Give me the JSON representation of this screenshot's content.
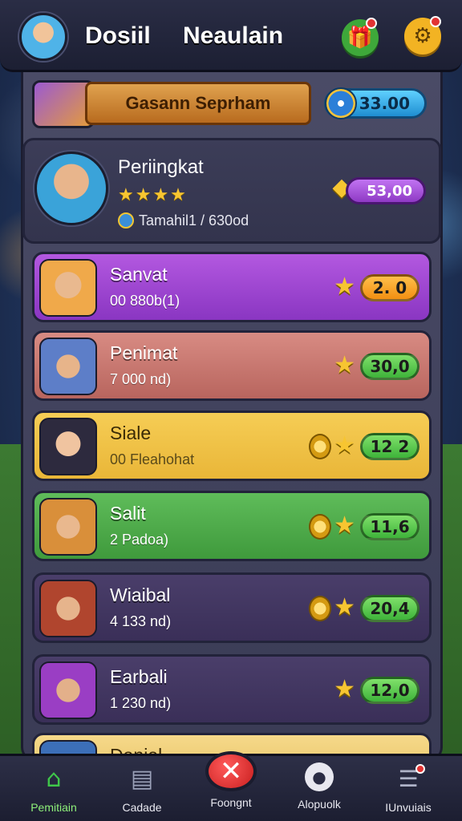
{
  "topbar": {
    "title_left": "Dosiil",
    "title_right": "Neaulain"
  },
  "header": {
    "event_banner": "Gasann Seprham",
    "currency_value": "33.00"
  },
  "player": {
    "name": "Periingkat",
    "stars": "★★★★",
    "subtitle": "Tamahil1 / 630od",
    "score": "53,00"
  },
  "rows": [
    {
      "name": "Sanvat",
      "sub": "00 880b(1)",
      "value": "2. 0"
    },
    {
      "name": "Penimat",
      "sub": "7 000 nd)",
      "value": "30,0"
    },
    {
      "name": "Siale",
      "sub": "00 Fleahohat",
      "value": "12 2"
    },
    {
      "name": "Salit",
      "sub": "2 Padoa)",
      "value": "11,6"
    },
    {
      "name": "Wiaibal",
      "sub": "4 133 nd)",
      "value": "20,4"
    },
    {
      "name": "Earbali",
      "sub": "1 230 nd)",
      "value": "12,0"
    },
    {
      "name": "Daniel",
      "sub": "",
      "value": ""
    }
  ],
  "nav": {
    "home": "Pemitiain",
    "cards": "Cadade",
    "center": "Foongnt",
    "profile": "Alopuolk",
    "inbox": "IUnvuiais"
  },
  "icons": {
    "gift": "gift-icon",
    "gear": "gear-icon",
    "home": "home-icon",
    "close": "close-icon"
  },
  "colors": {
    "accent_purple": "#8a36c2",
    "accent_green": "#3eb33a",
    "accent_orange": "#f28f12",
    "panel": "#3a3b55"
  }
}
